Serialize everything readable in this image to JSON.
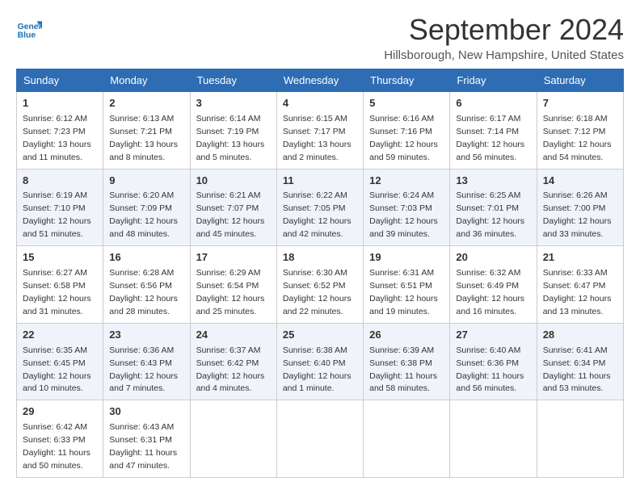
{
  "logo": {
    "line1": "General",
    "line2": "Blue"
  },
  "title": "September 2024",
  "location": "Hillsborough, New Hampshire, United States",
  "days_of_week": [
    "Sunday",
    "Monday",
    "Tuesday",
    "Wednesday",
    "Thursday",
    "Friday",
    "Saturday"
  ],
  "weeks": [
    [
      {
        "day": 1,
        "info": "Sunrise: 6:12 AM\nSunset: 7:23 PM\nDaylight: 13 hours\nand 11 minutes."
      },
      {
        "day": 2,
        "info": "Sunrise: 6:13 AM\nSunset: 7:21 PM\nDaylight: 13 hours\nand 8 minutes."
      },
      {
        "day": 3,
        "info": "Sunrise: 6:14 AM\nSunset: 7:19 PM\nDaylight: 13 hours\nand 5 minutes."
      },
      {
        "day": 4,
        "info": "Sunrise: 6:15 AM\nSunset: 7:17 PM\nDaylight: 13 hours\nand 2 minutes."
      },
      {
        "day": 5,
        "info": "Sunrise: 6:16 AM\nSunset: 7:16 PM\nDaylight: 12 hours\nand 59 minutes."
      },
      {
        "day": 6,
        "info": "Sunrise: 6:17 AM\nSunset: 7:14 PM\nDaylight: 12 hours\nand 56 minutes."
      },
      {
        "day": 7,
        "info": "Sunrise: 6:18 AM\nSunset: 7:12 PM\nDaylight: 12 hours\nand 54 minutes."
      }
    ],
    [
      {
        "day": 8,
        "info": "Sunrise: 6:19 AM\nSunset: 7:10 PM\nDaylight: 12 hours\nand 51 minutes."
      },
      {
        "day": 9,
        "info": "Sunrise: 6:20 AM\nSunset: 7:09 PM\nDaylight: 12 hours\nand 48 minutes."
      },
      {
        "day": 10,
        "info": "Sunrise: 6:21 AM\nSunset: 7:07 PM\nDaylight: 12 hours\nand 45 minutes."
      },
      {
        "day": 11,
        "info": "Sunrise: 6:22 AM\nSunset: 7:05 PM\nDaylight: 12 hours\nand 42 minutes."
      },
      {
        "day": 12,
        "info": "Sunrise: 6:24 AM\nSunset: 7:03 PM\nDaylight: 12 hours\nand 39 minutes."
      },
      {
        "day": 13,
        "info": "Sunrise: 6:25 AM\nSunset: 7:01 PM\nDaylight: 12 hours\nand 36 minutes."
      },
      {
        "day": 14,
        "info": "Sunrise: 6:26 AM\nSunset: 7:00 PM\nDaylight: 12 hours\nand 33 minutes."
      }
    ],
    [
      {
        "day": 15,
        "info": "Sunrise: 6:27 AM\nSunset: 6:58 PM\nDaylight: 12 hours\nand 31 minutes."
      },
      {
        "day": 16,
        "info": "Sunrise: 6:28 AM\nSunset: 6:56 PM\nDaylight: 12 hours\nand 28 minutes."
      },
      {
        "day": 17,
        "info": "Sunrise: 6:29 AM\nSunset: 6:54 PM\nDaylight: 12 hours\nand 25 minutes."
      },
      {
        "day": 18,
        "info": "Sunrise: 6:30 AM\nSunset: 6:52 PM\nDaylight: 12 hours\nand 22 minutes."
      },
      {
        "day": 19,
        "info": "Sunrise: 6:31 AM\nSunset: 6:51 PM\nDaylight: 12 hours\nand 19 minutes."
      },
      {
        "day": 20,
        "info": "Sunrise: 6:32 AM\nSunset: 6:49 PM\nDaylight: 12 hours\nand 16 minutes."
      },
      {
        "day": 21,
        "info": "Sunrise: 6:33 AM\nSunset: 6:47 PM\nDaylight: 12 hours\nand 13 minutes."
      }
    ],
    [
      {
        "day": 22,
        "info": "Sunrise: 6:35 AM\nSunset: 6:45 PM\nDaylight: 12 hours\nand 10 minutes."
      },
      {
        "day": 23,
        "info": "Sunrise: 6:36 AM\nSunset: 6:43 PM\nDaylight: 12 hours\nand 7 minutes."
      },
      {
        "day": 24,
        "info": "Sunrise: 6:37 AM\nSunset: 6:42 PM\nDaylight: 12 hours\nand 4 minutes."
      },
      {
        "day": 25,
        "info": "Sunrise: 6:38 AM\nSunset: 6:40 PM\nDaylight: 12 hours\nand 1 minute."
      },
      {
        "day": 26,
        "info": "Sunrise: 6:39 AM\nSunset: 6:38 PM\nDaylight: 11 hours\nand 58 minutes."
      },
      {
        "day": 27,
        "info": "Sunrise: 6:40 AM\nSunset: 6:36 PM\nDaylight: 11 hours\nand 56 minutes."
      },
      {
        "day": 28,
        "info": "Sunrise: 6:41 AM\nSunset: 6:34 PM\nDaylight: 11 hours\nand 53 minutes."
      }
    ],
    [
      {
        "day": 29,
        "info": "Sunrise: 6:42 AM\nSunset: 6:33 PM\nDaylight: 11 hours\nand 50 minutes."
      },
      {
        "day": 30,
        "info": "Sunrise: 6:43 AM\nSunset: 6:31 PM\nDaylight: 11 hours\nand 47 minutes."
      },
      null,
      null,
      null,
      null,
      null
    ]
  ]
}
